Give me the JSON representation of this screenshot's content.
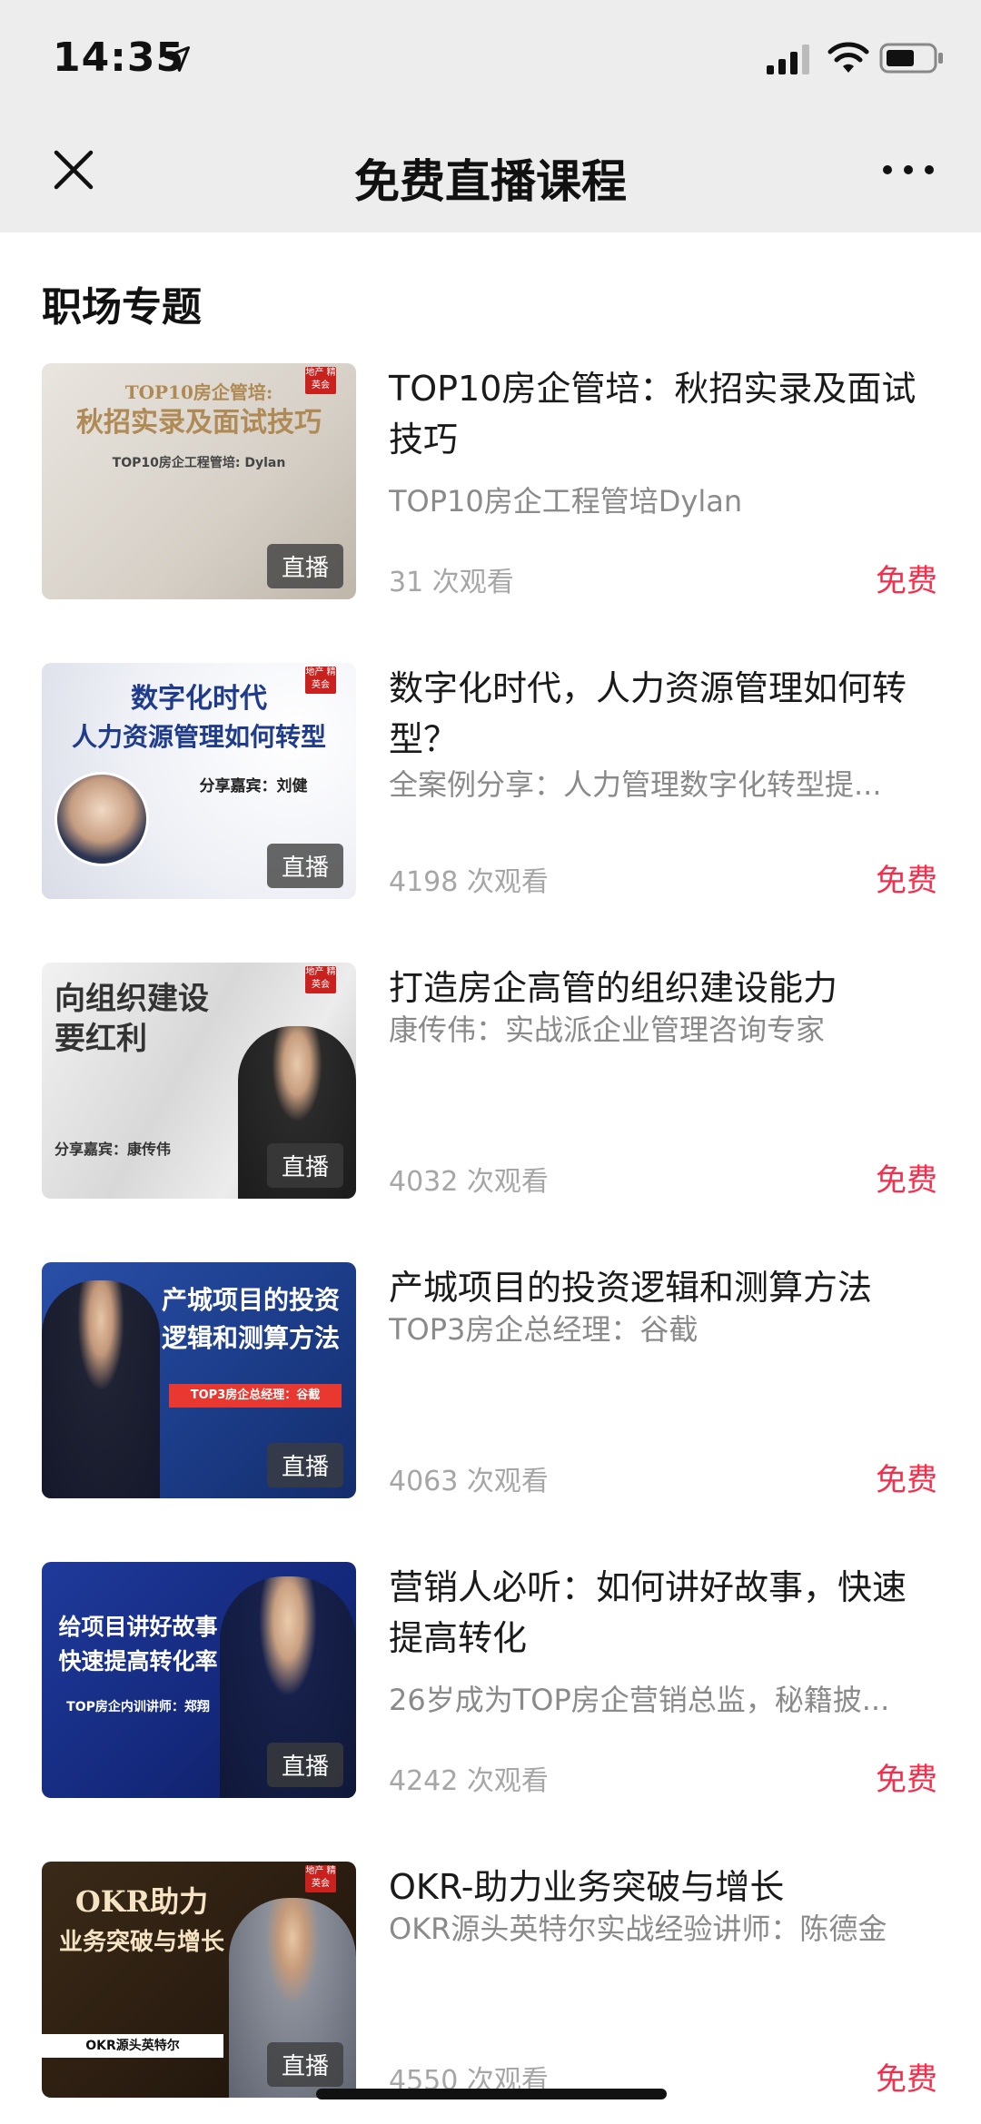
{
  "status_bar": {
    "time": "14:35"
  },
  "nav": {
    "title": "免费直播课程"
  },
  "section": {
    "title": "职场专题"
  },
  "courses": [
    {
      "title": "TOP10房企管培：秋招实录及面试技巧",
      "subtitle": "TOP10房企工程管培Dylan",
      "views": "31 次观看",
      "price": "免费",
      "badge": "直播",
      "thumb_line1": "TOP10房企管培:",
      "thumb_line2": "秋招实录及面试技巧",
      "thumb_line3": "TOP10房企工程管培: Dylan",
      "brand": "地产 精英会",
      "accent": "#c9a36b"
    },
    {
      "title": "数字化时代，人力资源管理如何转型？",
      "subtitle": "全案例分享：人力管理数字化转型提...",
      "views": "4198 次观看",
      "price": "免费",
      "badge": "直播",
      "thumb_line1": "数字化时代",
      "thumb_line2": "人力资源管理如何转型",
      "thumb_line3": "分享嘉宾：刘健",
      "brand": "地产 精英会",
      "accent": "#1f3b8c"
    },
    {
      "title": "打造房企高管的组织建设能力",
      "subtitle": "康传伟：实战派企业管理咨询专家",
      "views": "4032 次观看",
      "price": "免费",
      "badge": "直播",
      "thumb_line1": "向组织建设",
      "thumb_line2": "要红利",
      "thumb_line3": "分享嘉宾：康传伟",
      "brand": "地产 精英会",
      "accent": "#333333"
    },
    {
      "title": "产城项目的投资逻辑和测算方法",
      "subtitle": "TOP3房企总经理：谷截",
      "views": "4063 次观看",
      "price": "免费",
      "badge": "直播",
      "thumb_line1": "产城项目的投资",
      "thumb_line2": "逻辑和测算方法",
      "thumb_line3": "TOP3房企总经理：谷截",
      "brand": "",
      "accent": "#1c3d8a"
    },
    {
      "title": "营销人必听：如何讲好故事，快速提高转化",
      "subtitle": "26岁成为TOP房企营销总监，秘籍披...",
      "views": "4242 次观看",
      "price": "免费",
      "badge": "直播",
      "thumb_line1": "给项目讲好故事",
      "thumb_line2": "快速提高转化率",
      "thumb_line3": "TOP房企内训讲师：郑翔",
      "brand": "",
      "accent": "#14287a"
    },
    {
      "title": "OKR-助力业务突破与增长",
      "subtitle": "OKR源头英特尔实战经验讲师：陈德金",
      "views": "4550 次观看",
      "price": "免费",
      "badge": "直播",
      "thumb_line1": "OKR助力",
      "thumb_line2": "业务突破与增长",
      "thumb_line3": "OKR源头英特尔",
      "brand": "地产 精英会",
      "accent": "#2b1d10"
    }
  ]
}
